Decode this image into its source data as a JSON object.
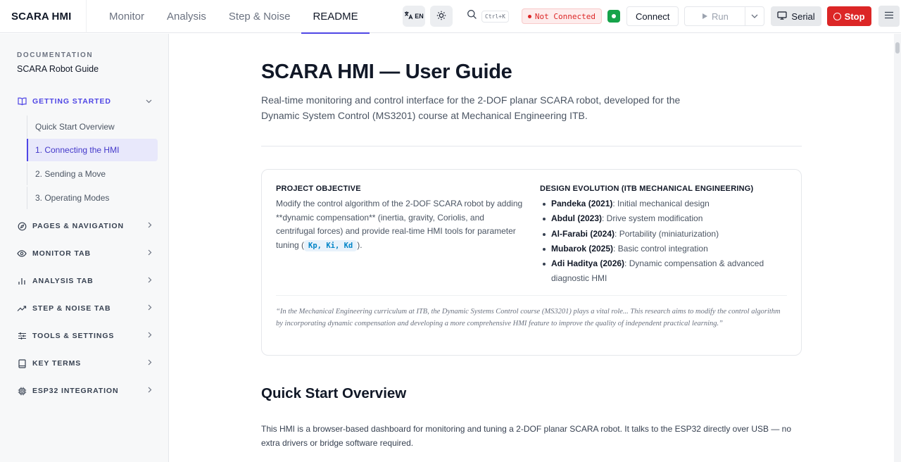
{
  "app": {
    "title": "SCARA HMI"
  },
  "nav": {
    "tabs": [
      {
        "label": "Monitor"
      },
      {
        "label": "Analysis"
      },
      {
        "label": "Step & Noise"
      },
      {
        "label": "README"
      }
    ]
  },
  "toolbar": {
    "lang_label": "EN",
    "search_shortcut": "Ctrl+K",
    "status_text": "Not Connected",
    "connect_label": "Connect",
    "run_label": "Run",
    "serial_label": "Serial",
    "stop_label": "Stop"
  },
  "sidebar": {
    "eyebrow": "DOCUMENTATION",
    "title": "SCARA Robot Guide",
    "sections": [
      {
        "label": "GETTING STARTED",
        "icon": "book-icon"
      },
      {
        "label": "PAGES & NAVIGATION",
        "icon": "compass-icon"
      },
      {
        "label": "MONITOR TAB",
        "icon": "eye-icon"
      },
      {
        "label": "ANALYSIS TAB",
        "icon": "bar-chart-icon"
      },
      {
        "label": "STEP & NOISE TAB",
        "icon": "trend-icon"
      },
      {
        "label": "TOOLS & SETTINGS",
        "icon": "sliders-icon"
      },
      {
        "label": "KEY TERMS",
        "icon": "notebook-icon"
      },
      {
        "label": "ESP32 INTEGRATION",
        "icon": "chip-icon"
      }
    ],
    "getting_started_items": [
      {
        "label": "Quick Start Overview"
      },
      {
        "label": "1. Connecting the HMI"
      },
      {
        "label": "2. Sending a Move"
      },
      {
        "label": "3. Operating Modes"
      }
    ]
  },
  "content": {
    "h1": "SCARA HMI — User Guide",
    "lede": "Real-time monitoring and control interface for the 2-DOF planar SCARA robot, developed for the Dynamic System Control (MS3201) course at Mechanical Engineering ITB.",
    "objective": {
      "heading": "PROJECT OBJECTIVE",
      "text_before": "Modify the control algorithm of the 2-DOF SCARA robot by adding **dynamic compensation** (inertia, gravity, Coriolis, and centrifugal forces) and provide real-time HMI tools for parameter tuning (",
      "code": "Kp, Ki, Kd",
      "text_after": ")."
    },
    "evolution": {
      "heading": "DESIGN EVOLUTION (ITB MECHANICAL ENGINEERING)",
      "items": [
        {
          "name": "Pandeka (2021)",
          "desc": ": Initial mechanical design"
        },
        {
          "name": "Abdul (2023)",
          "desc": ": Drive system modification"
        },
        {
          "name": "Al-Farabi (2024)",
          "desc": ": Portability (miniaturization)"
        },
        {
          "name": "Mubarok (2025)",
          "desc": ": Basic control integration"
        },
        {
          "name": "Adi Haditya (2026)",
          "desc": ": Dynamic compensation & advanced diagnostic HMI"
        }
      ]
    },
    "quote": "“In the Mechanical Engineering curriculum at ITB, the Dynamic Systems Control course (MS3201) plays a vital role... This research aims to modify the control algorithm by incorporating dynamic compensation and developing a more comprehensive HMI feature to improve the quality of independent practical learning.”",
    "h2": "Quick Start Overview",
    "body": "This HMI is a browser-based dashboard for monitoring and tuning a 2-DOF planar SCARA robot. It talks to the ESP32 directly over USB — no extra drivers or bridge software required."
  }
}
